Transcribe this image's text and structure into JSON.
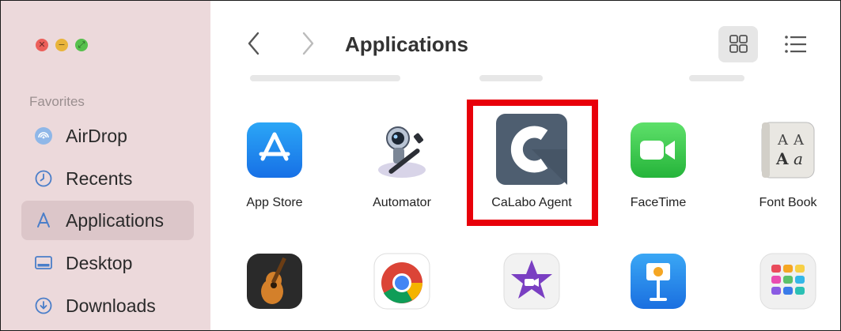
{
  "window": {
    "title": "Applications"
  },
  "sidebar": {
    "section_header": "Favorites",
    "items": [
      {
        "label": "AirDrop",
        "icon": "airdrop-icon",
        "selected": false
      },
      {
        "label": "Recents",
        "icon": "clock-icon",
        "selected": false
      },
      {
        "label": "Applications",
        "icon": "applications-icon",
        "selected": true
      },
      {
        "label": "Desktop",
        "icon": "desktop-icon",
        "selected": false
      },
      {
        "label": "Downloads",
        "icon": "downloads-icon",
        "selected": false
      }
    ]
  },
  "toolbar": {
    "back_icon": "chevron-left-icon",
    "forward_icon": "chevron-right-icon",
    "grid_view_icon": "grid-view-icon",
    "list_view_icon": "list-view-icon"
  },
  "apps": [
    {
      "label": "App Store",
      "icon": "app-store-icon"
    },
    {
      "label": "Automator",
      "icon": "automator-icon"
    },
    {
      "label": "CaLabo Agent",
      "icon": "calabo-agent-icon",
      "highlighted": true
    },
    {
      "label": "FaceTime",
      "icon": "facetime-icon"
    },
    {
      "label": "Font Book",
      "icon": "font-book-icon"
    },
    {
      "label": "",
      "icon": "garageband-icon"
    },
    {
      "label": "",
      "icon": "google-chrome-icon"
    },
    {
      "label": "",
      "icon": "imovie-icon"
    },
    {
      "label": "",
      "icon": "keynote-icon"
    },
    {
      "label": "",
      "icon": "launchpad-icon"
    }
  ],
  "colors": {
    "sidebar_bg": "#ecd9db",
    "selected_bg": "#dcc6c9",
    "highlight_border": "#e8000a"
  }
}
